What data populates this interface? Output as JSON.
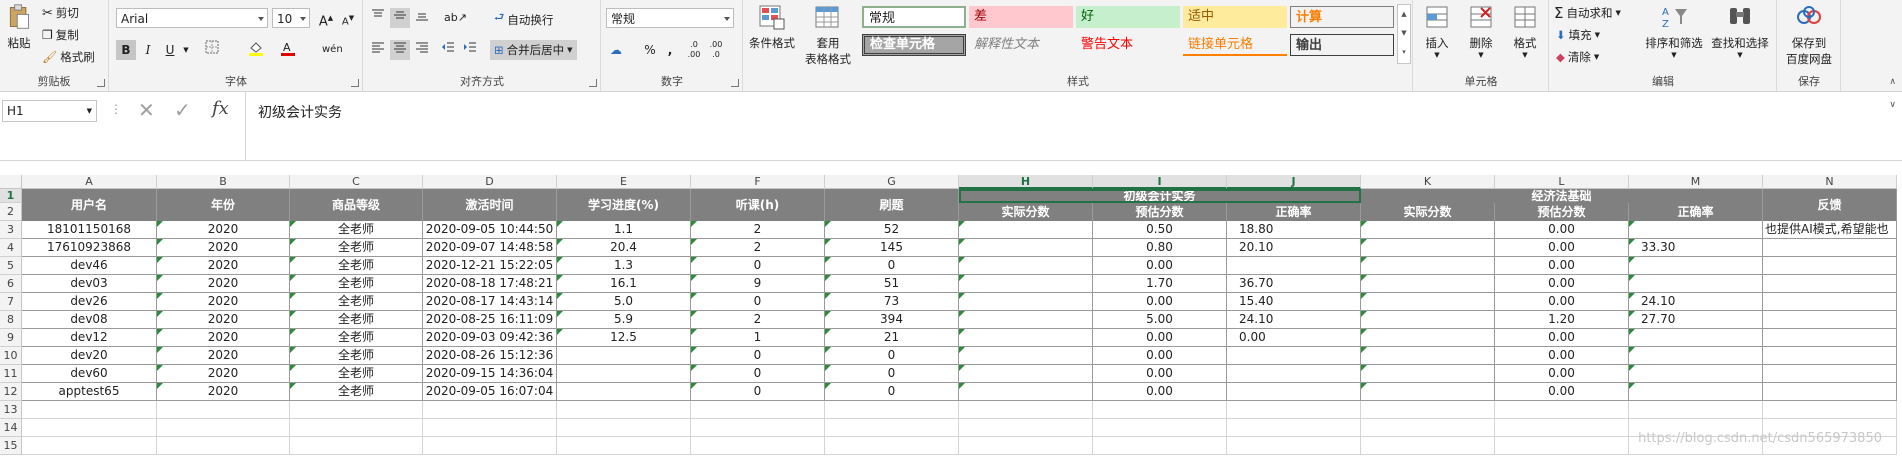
{
  "clipboard": {
    "paste": "粘贴",
    "cut": "剪切",
    "copy": "复制",
    "format_painter": "格式刷",
    "label": "剪贴板"
  },
  "font": {
    "name": "Arial",
    "size": "10",
    "bold": "B",
    "italic": "I",
    "underline": "U",
    "label": "字体",
    "grow": "A",
    "shrink": "A",
    "phonetic": "wén"
  },
  "alignment": {
    "wrap": "自动换行",
    "merge": "合并后居中",
    "label": "对齐方式"
  },
  "number": {
    "format": "常规",
    "percent": "%",
    "comma": ",",
    "label": "数字"
  },
  "styles": {
    "conditional": "条件格式",
    "table_format_1": "套用",
    "table_format_2": "表格格式",
    "label": "样式",
    "cells": [
      "常规",
      "差",
      "好",
      "适中",
      "计算",
      "检查单元格",
      "解释性文本",
      "警告文本",
      "链接单元格",
      "输出"
    ]
  },
  "cells_group": {
    "insert": "插入",
    "delete": "删除",
    "format": "格式",
    "label": "单元格"
  },
  "editing": {
    "autosum": "自动求和",
    "fill": "填充",
    "clear": "清除",
    "sort": "排序和筛选",
    "find": "查找和选择",
    "label": "编辑"
  },
  "save": {
    "line1": "保存到",
    "line2": "百度网盘",
    "label": "保存"
  },
  "formula_bar": {
    "name_box": "H1",
    "fx": "fx",
    "content": "初级会计实务"
  },
  "columns": [
    "A",
    "B",
    "C",
    "D",
    "E",
    "F",
    "G",
    "H",
    "I",
    "J",
    "K",
    "L",
    "M",
    "N"
  ],
  "rows": [
    "1",
    "2",
    "3",
    "4",
    "5",
    "6",
    "7",
    "8",
    "9",
    "10",
    "11",
    "12",
    "13",
    "14",
    "15"
  ],
  "header": {
    "user": "用户名",
    "year": "年份",
    "level": "商品等级",
    "activated": "激活时间",
    "progress": "学习进度(%)",
    "lessons": "听课(h)",
    "practice": "刷题",
    "group1": "初级会计实务",
    "group2": "经济法基础",
    "feedback": "反馈",
    "actual": "实际分数",
    "estimate": "预估分数",
    "accuracy": "正确率"
  },
  "data": [
    [
      "18101150168",
      "2020",
      "全老师",
      "2020-09-05 10:44:50",
      "1.1",
      "2",
      "52",
      "",
      "0.50",
      "18.80",
      "",
      "0.00",
      "",
      "也提供AI模式,希望能也"
    ],
    [
      "17610923868",
      "2020",
      "全老师",
      "2020-09-07 14:48:58",
      "20.4",
      "2",
      "145",
      "",
      "0.80",
      "20.10",
      "",
      "0.00",
      "33.30",
      ""
    ],
    [
      "dev46",
      "2020",
      "全老师",
      "2020-12-21 15:22:05",
      "1.3",
      "0",
      "0",
      "",
      "0.00",
      "",
      "",
      "0.00",
      "",
      ""
    ],
    [
      "dev03",
      "2020",
      "全老师",
      "2020-08-18 17:48:21",
      "16.1",
      "9",
      "51",
      "",
      "1.70",
      "36.70",
      "",
      "0.00",
      "",
      ""
    ],
    [
      "dev26",
      "2020",
      "全老师",
      "2020-08-17 14:43:14",
      "5.0",
      "0",
      "73",
      "",
      "0.00",
      "15.40",
      "",
      "0.00",
      "24.10",
      ""
    ],
    [
      "dev08",
      "2020",
      "全老师",
      "2020-08-25 16:11:09",
      "5.9",
      "2",
      "394",
      "",
      "5.00",
      "24.10",
      "",
      "1.20",
      "27.70",
      ""
    ],
    [
      "dev12",
      "2020",
      "全老师",
      "2020-09-03 09:42:36",
      "12.5",
      "1",
      "21",
      "",
      "0.00",
      "0.00",
      "",
      "0.00",
      "",
      ""
    ],
    [
      "dev20",
      "2020",
      "全老师",
      "2020-08-26 15:12:36",
      "",
      "0",
      "0",
      "",
      "0.00",
      "",
      "",
      "0.00",
      "",
      ""
    ],
    [
      "dev60",
      "2020",
      "全老师",
      "2020-09-15 14:36:04",
      "",
      "0",
      "0",
      "",
      "0.00",
      "",
      "",
      "0.00",
      "",
      ""
    ],
    [
      "apptest65",
      "2020",
      "全老师",
      "2020-09-05 16:07:04",
      "",
      "0",
      "0",
      "",
      "0.00",
      "",
      "",
      "0.00",
      "",
      ""
    ]
  ],
  "watermark": "https://blog.csdn.net/csdn565973850"
}
